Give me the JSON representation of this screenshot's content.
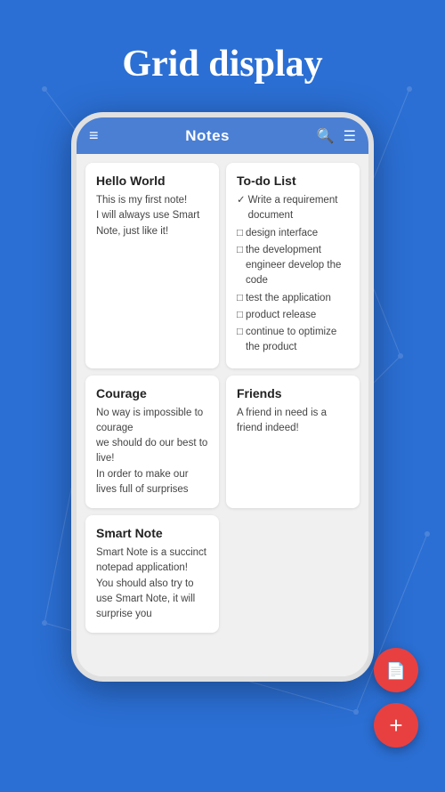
{
  "page": {
    "title": "Grid display",
    "background_color": "#2b6fd4"
  },
  "toolbar": {
    "title": "Notes",
    "menu_icon": "≡",
    "search_icon": "🔍",
    "filter_icon": "☰"
  },
  "notes": [
    {
      "id": "hello-world",
      "title": "Hello World",
      "body": "This is my first note!\nI will always use Smart Note, just like it!",
      "type": "text"
    },
    {
      "id": "to-do-list",
      "title": "To-do List",
      "type": "checklist",
      "items": [
        {
          "checked": true,
          "text": "Write a requirement document"
        },
        {
          "checked": false,
          "text": "design interface"
        },
        {
          "checked": false,
          "text": "the development engineer develop the code"
        },
        {
          "checked": false,
          "text": "test the application"
        },
        {
          "checked": false,
          "text": "product release"
        },
        {
          "checked": false,
          "text": "continue to optimize the product"
        }
      ]
    },
    {
      "id": "courage",
      "title": "Courage",
      "body": "No way is impossible to courage\nwe should do our best to live!\nIn order to make our lives full of surprises",
      "type": "text"
    },
    {
      "id": "friends",
      "title": "Friends",
      "body": "A friend in need is a friend indeed!",
      "type": "text"
    },
    {
      "id": "smart-note",
      "title": "Smart Note",
      "body": "Smart Note is a succinct notepad application!\nYou should also try to use Smart Note, it will surprise you",
      "type": "text"
    }
  ],
  "fabs": {
    "doc_label": "📄",
    "add_label": "+"
  }
}
